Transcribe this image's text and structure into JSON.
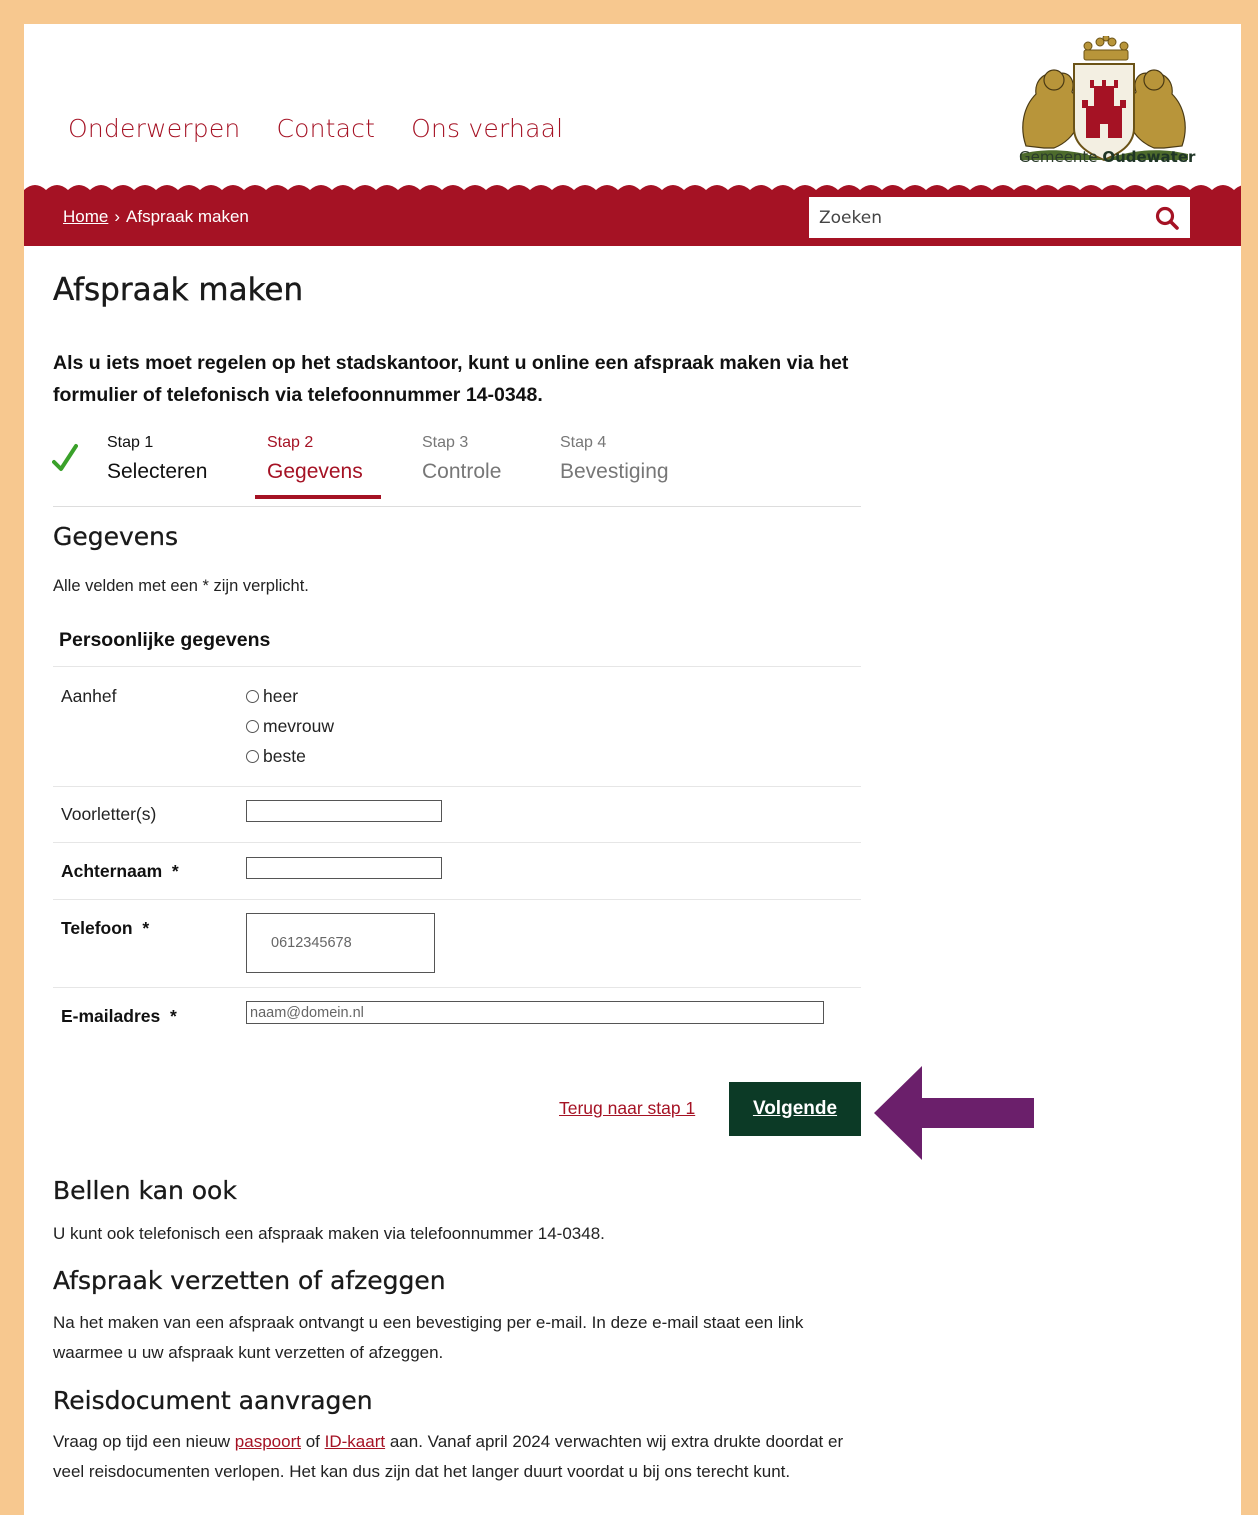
{
  "nav": {
    "items": [
      "Onderwerpen",
      "Contact",
      "Ons verhaal"
    ]
  },
  "logo": {
    "text_prefix": "Gemeente",
    "text_bold": "Oudewater"
  },
  "breadcrumb": {
    "home": "Home",
    "separator": "›",
    "current": "Afspraak maken"
  },
  "search": {
    "placeholder": "Zoeken",
    "icon": "search-icon"
  },
  "page": {
    "title": "Afspraak maken",
    "intro": "Als u iets moet regelen op het stadskantoor, kunt u online een afspraak maken via het formulier of telefonisch via telefoonnummer 14-0348."
  },
  "steps": [
    {
      "number": "Stap 1",
      "label": "Selecteren",
      "state": "done"
    },
    {
      "number": "Stap 2",
      "label": "Gegevens",
      "state": "active"
    },
    {
      "number": "Stap 3",
      "label": "Controle",
      "state": "todo"
    },
    {
      "number": "Stap 4",
      "label": "Bevestiging",
      "state": "todo"
    }
  ],
  "form": {
    "title": "Gegevens",
    "required_note": "Alle velden met een * zijn verplicht.",
    "fieldset_title": "Persoonlijke gegevens",
    "salutation": {
      "label": "Aanhef",
      "options": [
        "heer",
        "mevrouw",
        "beste"
      ]
    },
    "initials": {
      "label": "Voorletter(s)",
      "value": ""
    },
    "surname": {
      "label": "Achternaam",
      "required_mark": "*",
      "value": ""
    },
    "phone": {
      "label": "Telefoon",
      "required_mark": "*",
      "placeholder": "0612345678"
    },
    "email": {
      "label": "E-mailadres",
      "required_mark": "*",
      "placeholder": "naam@domein.nl"
    },
    "back_link": "Terug naar stap 1",
    "next_button": "Volgende"
  },
  "sections": {
    "call": {
      "title": "Bellen kan ook",
      "text": "U kunt ook telefonisch een afspraak maken via telefoonnummer 14-0348."
    },
    "reschedule": {
      "title": "Afspraak verzetten of afzeggen",
      "text": "Na het maken van een afspraak ontvangt u een bevestiging per e-mail. In deze e-mail staat een link waarmee u uw afspraak kunt verzetten of afzeggen."
    },
    "travel": {
      "title": "Reisdocument aanvragen",
      "text_1": "Vraag op tijd een nieuw",
      "link_passport": "paspoort",
      "text_2": "of",
      "link_id": "ID-kaart",
      "text_3": "aan. Vanaf april 2024 verwachten wij extra drukte doordat er veel reisdocumenten verlopen. Het kan dus zijn dat het langer duurt voordat u bij ons terecht kunt."
    }
  },
  "colors": {
    "brand_red": "#a51224",
    "dark_green": "#0c3a26",
    "frame": "#f7c88f",
    "arrow_purple": "#6b1f6b"
  }
}
